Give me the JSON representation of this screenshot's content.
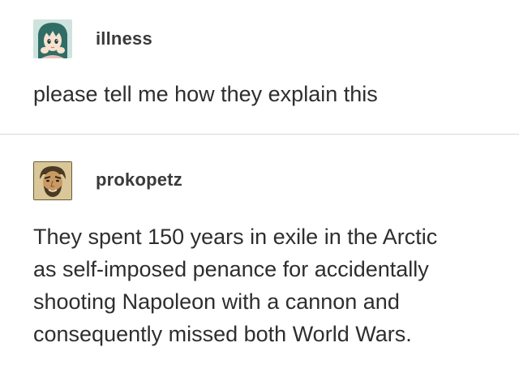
{
  "posts": [
    {
      "username": "illness",
      "avatar_icon": "anime-girl-avatar-icon",
      "lines": [
        "please tell me how they explain this"
      ]
    },
    {
      "username": "prokopetz",
      "avatar_icon": "bearded-man-avatar-icon",
      "lines": [
        "They spent 150 years in exile in the Arctic",
        "as self-imposed penance for accidentally",
        "shooting Napoleon with a cannon and",
        "consequently missed both World Wars."
      ]
    }
  ]
}
